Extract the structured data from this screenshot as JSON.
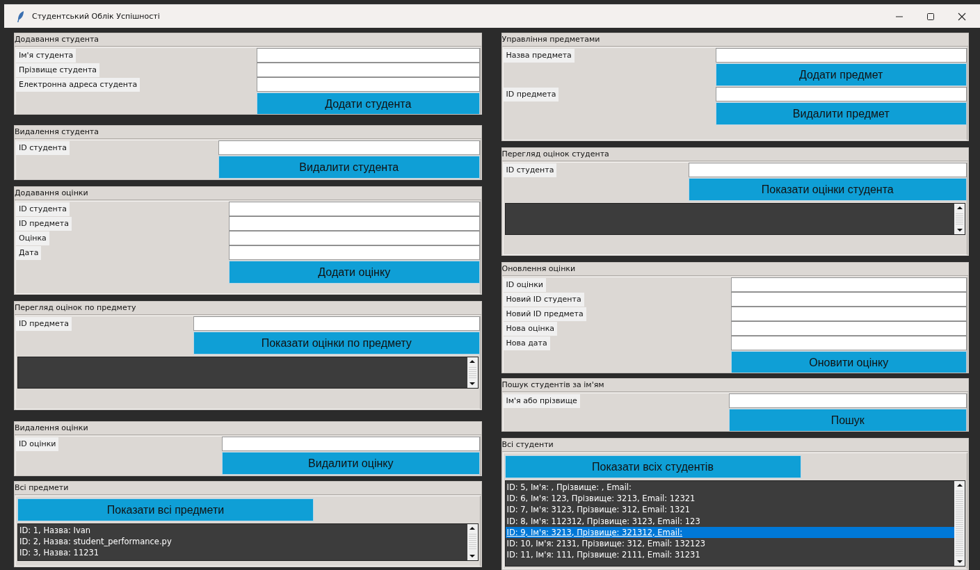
{
  "window": {
    "title": "Студентський Облік Успішності"
  },
  "columns": [
    {
      "sections": [
        {
          "title": "Додавання студента",
          "rows": [
            {
              "kind": "field",
              "label": "Ім'я студента"
            },
            {
              "kind": "field",
              "label": "Прізвище студента"
            },
            {
              "kind": "field",
              "label": "Електронна адреса студента"
            },
            {
              "kind": "button",
              "text": "Додати студента"
            }
          ]
        },
        {
          "title": "Видалення студента",
          "rows": [
            {
              "kind": "field",
              "label": "ID студента"
            },
            {
              "kind": "button",
              "text": "Видалити студента"
            }
          ]
        },
        {
          "title": "Додавання оцінки",
          "rows": [
            {
              "kind": "field",
              "label": "ID студента"
            },
            {
              "kind": "field",
              "label": "ID предмета"
            },
            {
              "kind": "field",
              "label": "Оцінка"
            },
            {
              "kind": "field",
              "label": "Дата"
            },
            {
              "kind": "button",
              "text": "Додати оцінку"
            }
          ]
        },
        {
          "title": "Перегляд оцінок по предмету",
          "rows": [
            {
              "kind": "field",
              "label": "ID предмета"
            },
            {
              "kind": "button",
              "text": "Показати оцінки по предмету"
            },
            {
              "kind": "list",
              "lines": []
            }
          ]
        },
        {
          "title": "Видалення оцінки",
          "rows": [
            {
              "kind": "field",
              "label": "ID оцінки"
            },
            {
              "kind": "button",
              "text": "Видалити оцінку"
            }
          ]
        },
        {
          "title": "Всі предмети",
          "rows": [
            {
              "kind": "wide-button",
              "text": "Показати всі предмети"
            },
            {
              "kind": "list",
              "lines": [
                {
                  "text": "ID: 1, Назва: Ivan",
                  "selected": false
                },
                {
                  "text": "ID: 2, Назва: student_performance.py",
                  "selected": false
                },
                {
                  "text": "ID: 3, Назва: 11231",
                  "selected": false
                }
              ]
            }
          ]
        }
      ]
    },
    {
      "sections": [
        {
          "title": "Управління предметами",
          "rows": [
            {
              "kind": "field",
              "label": "Назва предмета"
            },
            {
              "kind": "button",
              "text": "Додати предмет"
            },
            {
              "kind": "field",
              "label": "ID предмета"
            },
            {
              "kind": "button",
              "text": "Видалити предмет"
            }
          ]
        },
        {
          "title": "Перегляд оцінок студента",
          "rows": [
            {
              "kind": "field",
              "label": "ID студента"
            },
            {
              "kind": "button",
              "text": "Показати оцінки студента"
            },
            {
              "kind": "list",
              "lines": []
            }
          ]
        },
        {
          "title": "Оновлення оцінки",
          "rows": [
            {
              "kind": "field",
              "label": "ID оцінки"
            },
            {
              "kind": "field",
              "label": "Новий ID студента"
            },
            {
              "kind": "field",
              "label": "Новий ID предмета"
            },
            {
              "kind": "field",
              "label": "Нова оцінка"
            },
            {
              "kind": "field",
              "label": "Нова дата"
            },
            {
              "kind": "button",
              "text": "Оновити оцінку"
            }
          ]
        },
        {
          "title": "Пошук студентів за ім'ям",
          "rows": [
            {
              "kind": "field",
              "label": "Ім'я або прізвище"
            },
            {
              "kind": "button",
              "text": "Пошук"
            }
          ]
        },
        {
          "title": "Всі студенти",
          "rows": [
            {
              "kind": "wide-button",
              "text": "Показати всіх студентів"
            },
            {
              "kind": "list",
              "lines": [
                {
                  "text": "ID: 5, Ім'я: , Прізвище: , Email:",
                  "selected": false
                },
                {
                  "text": "ID: 6, Ім'я: 123, Прізвище: 3213, Email: 12321",
                  "selected": false
                },
                {
                  "text": "ID: 7, Ім'я: 3123, Прізвище: 312, Email: 1321",
                  "selected": false
                },
                {
                  "text": "ID: 8, Ім'я: 112312, Прізвище: 3123, Email: 123",
                  "selected": false
                },
                {
                  "text": "ID: 9, Ім'я: 3213, Прізвище: 321312, Email:",
                  "selected": true
                },
                {
                  "text": "ID: 10, Ім'я: 2131, Прізвище: 312, Email: 132123",
                  "selected": false
                },
                {
                  "text": "ID: 11, Ім'я: 111, Прізвище: 2111, Email: 31231",
                  "selected": false
                }
              ]
            }
          ]
        }
      ]
    }
  ]
}
